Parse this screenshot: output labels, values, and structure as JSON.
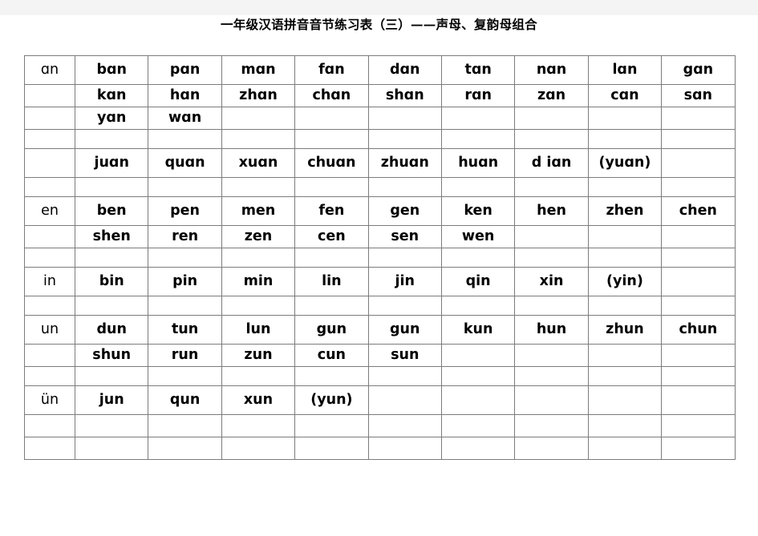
{
  "document": {
    "title": "一年级汉语拼音音节练习表（三）——声母、复韵母组合"
  },
  "table": {
    "columns": 10,
    "rows": [
      {
        "height": "tall",
        "cells": [
          "ɑn",
          "bɑn",
          "pɑn",
          "mɑn",
          "fɑn",
          "dɑn",
          "tɑn",
          "nɑn",
          "lɑn",
          "gɑn"
        ]
      },
      {
        "height": "mid",
        "cells": [
          "",
          "kɑn",
          "hɑn",
          "zhɑn",
          "chɑn",
          "shɑn",
          "rɑn",
          "zɑn",
          "cɑn",
          "sɑn"
        ]
      },
      {
        "height": "mid",
        "cells": [
          "",
          "yɑn",
          "wɑn",
          "",
          "",
          "",
          "",
          "",
          "",
          ""
        ]
      },
      {
        "height": "short",
        "cells": [
          "",
          "",
          "",
          "",
          "",
          "",
          "",
          "",
          "",
          ""
        ]
      },
      {
        "height": "tall",
        "cells": [
          "",
          "juɑn",
          "quɑn",
          "xuɑn",
          "chuɑn",
          "zhuɑn",
          "huɑn",
          "d iɑn",
          "(yuɑn)",
          ""
        ]
      },
      {
        "height": "short",
        "cells": [
          "",
          "",
          "",
          "",
          "",
          "",
          "",
          "",
          "",
          ""
        ]
      },
      {
        "height": "tall",
        "cells": [
          "en",
          "ben",
          "pen",
          "men",
          "fen",
          "gen",
          "ken",
          "hen",
          "zhen",
          "chen"
        ]
      },
      {
        "height": "mid",
        "cells": [
          "",
          "shen",
          "ren",
          "zen",
          "cen",
          "sen",
          "wen",
          "",
          "",
          ""
        ]
      },
      {
        "height": "short",
        "cells": [
          "",
          "",
          "",
          "",
          "",
          "",
          "",
          "",
          "",
          ""
        ]
      },
      {
        "height": "tall",
        "cells": [
          "in",
          "bin",
          "pin",
          "min",
          "lin",
          "jin",
          "qin",
          "xin",
          "(yin)",
          ""
        ]
      },
      {
        "height": "short",
        "cells": [
          "",
          "",
          "",
          "",
          "",
          "",
          "",
          "",
          "",
          ""
        ]
      },
      {
        "height": "tall",
        "cells": [
          "un",
          "dun",
          "tun",
          "lun",
          "gun",
          "gun",
          "kun",
          "hun",
          "zhun",
          "chun"
        ]
      },
      {
        "height": "mid",
        "cells": [
          "",
          "shun",
          "run",
          "zun",
          "cun",
          "sun",
          "",
          "",
          "",
          ""
        ]
      },
      {
        "height": "short",
        "cells": [
          "",
          "",
          "",
          "",
          "",
          "",
          "",
          "",
          "",
          ""
        ]
      },
      {
        "height": "tall",
        "cells": [
          "ün",
          "jun",
          "qun",
          "xun",
          "(yun)",
          "",
          "",
          "",
          "",
          ""
        ]
      },
      {
        "height": "mid",
        "cells": [
          "",
          "",
          "",
          "",
          "",
          "",
          "",
          "",
          "",
          ""
        ]
      },
      {
        "height": "mid",
        "cells": [
          "",
          "",
          "",
          "",
          "",
          "",
          "",
          "",
          "",
          ""
        ]
      }
    ]
  }
}
